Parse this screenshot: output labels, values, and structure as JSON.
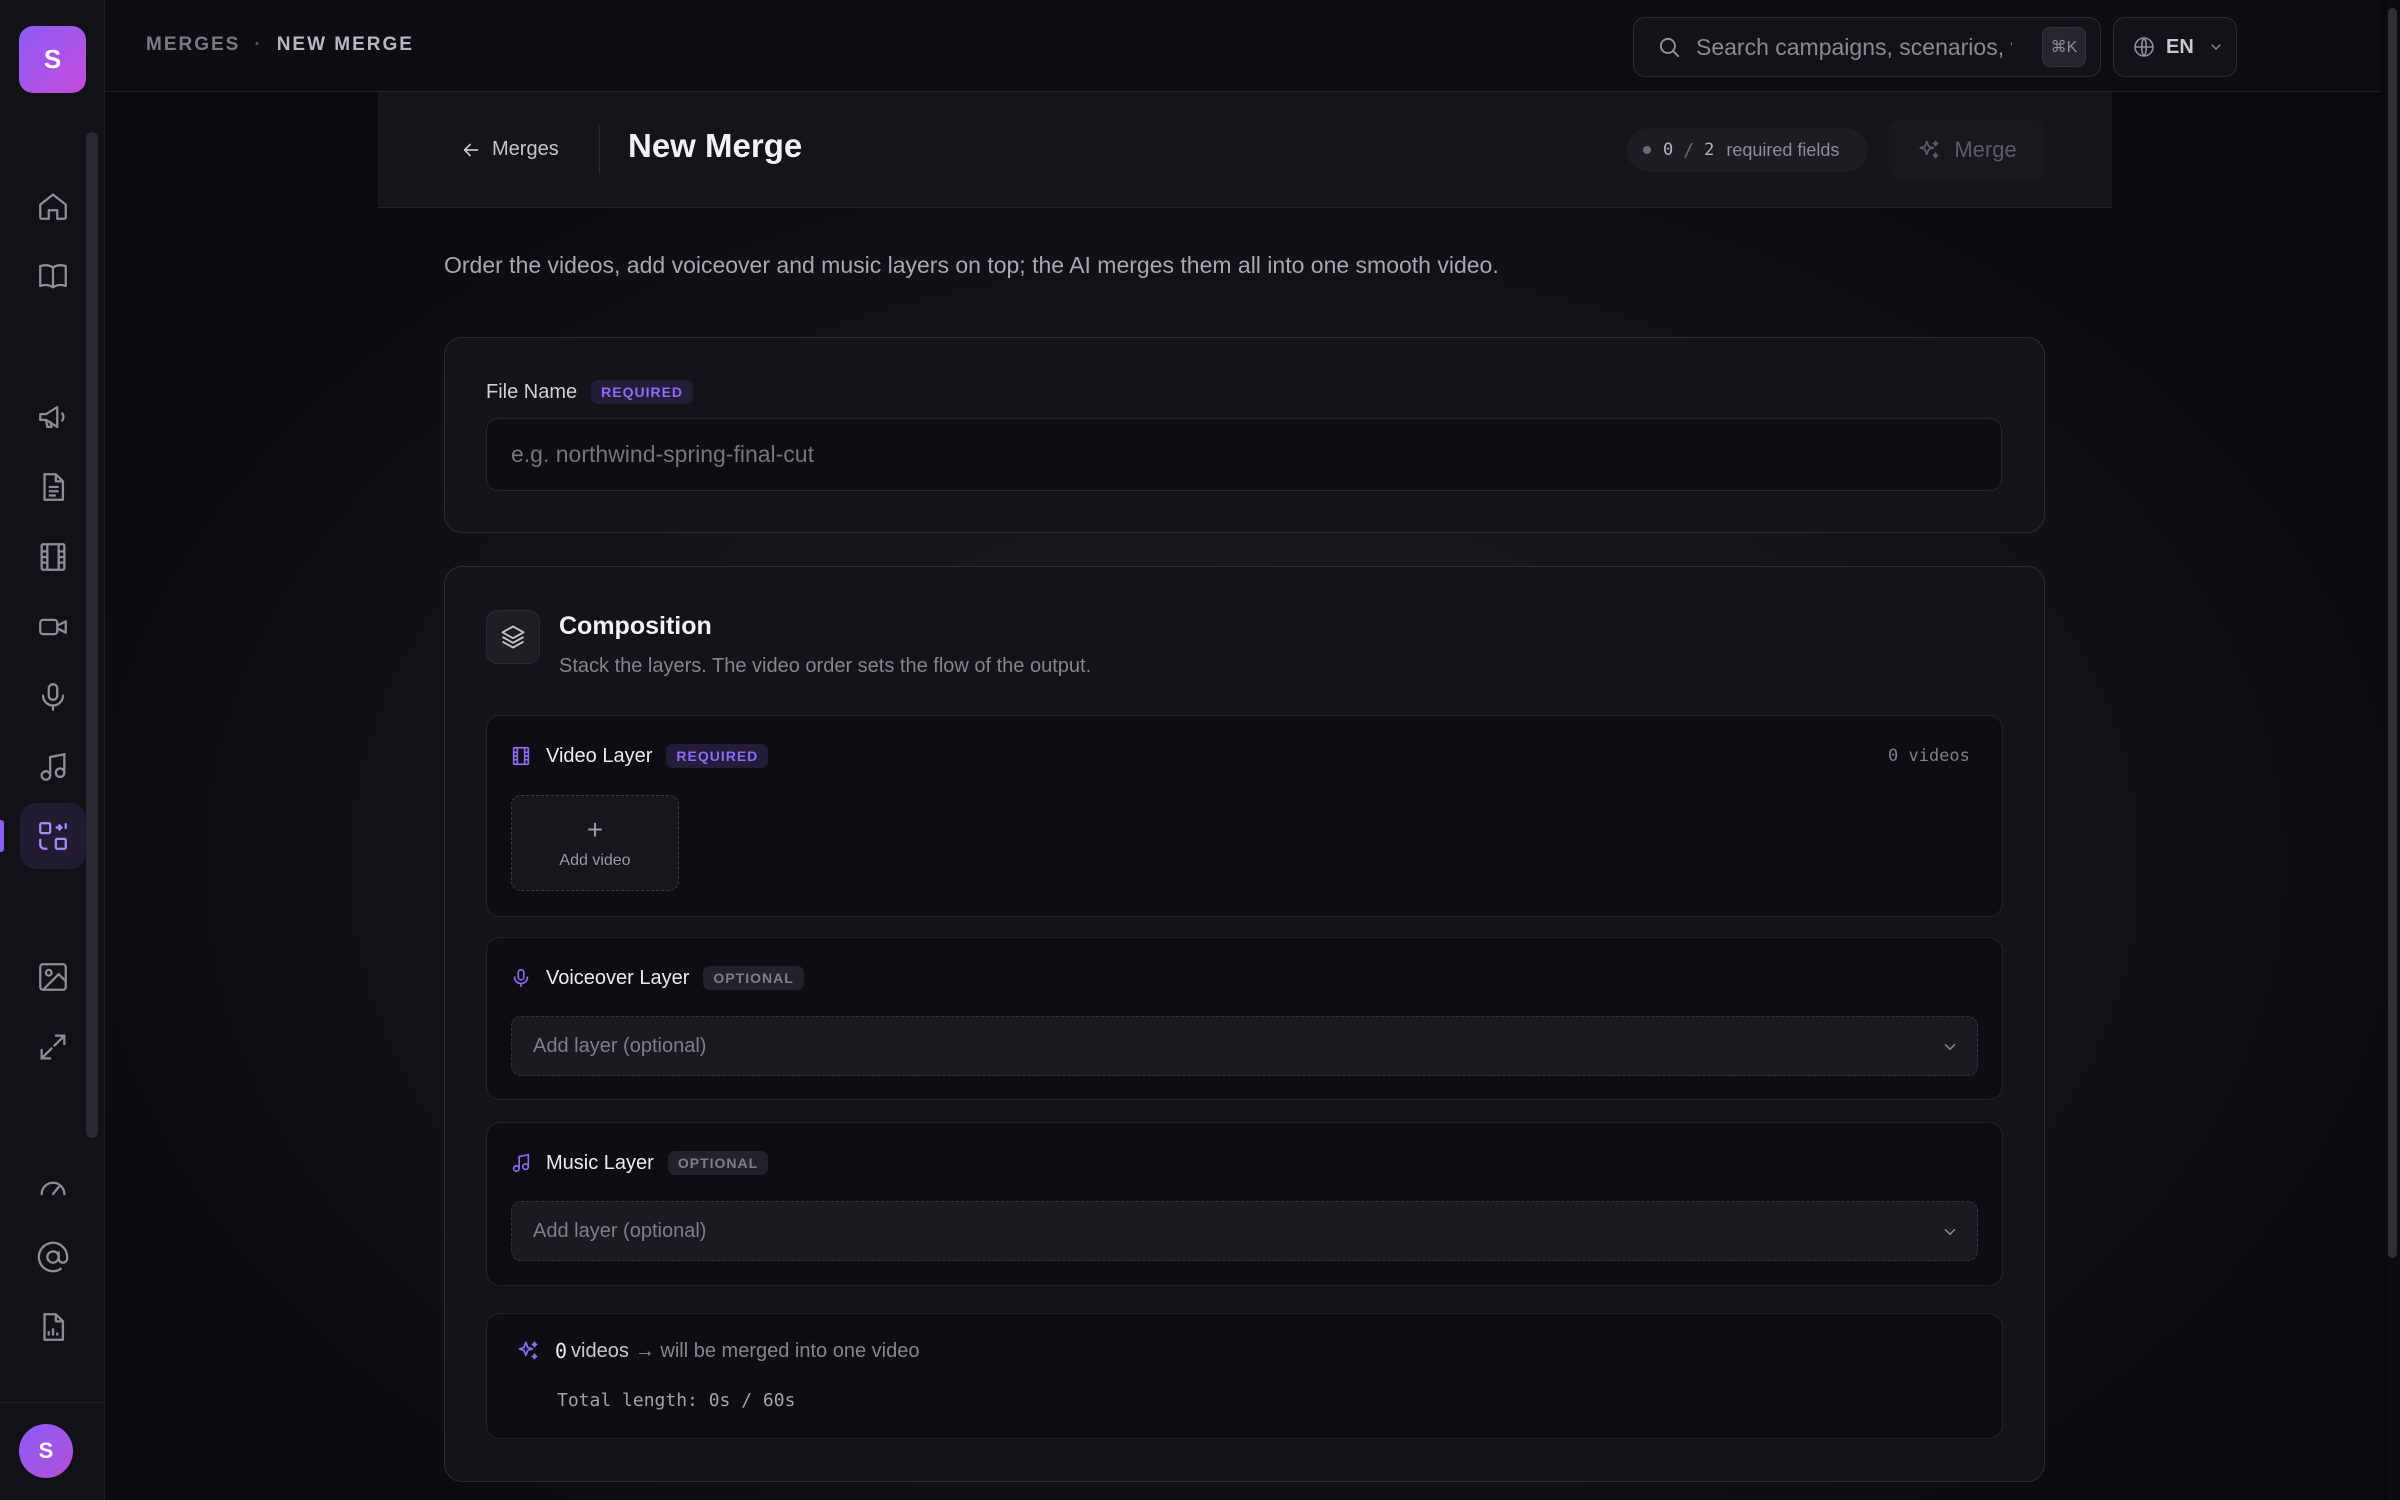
{
  "app": {
    "logo_letter": "S",
    "user_initial": "S",
    "accent": "#8b5cf6"
  },
  "breadcrumb": {
    "parent": "MERGES",
    "separator": "·",
    "current": "NEW MERGE"
  },
  "search": {
    "placeholder": "Search campaigns, scenarios, vi",
    "shortcut": "⌘K"
  },
  "language": {
    "value": "EN"
  },
  "sidebar": {
    "items": [
      {
        "icon": "home-icon"
      },
      {
        "icon": "book-icon"
      },
      {
        "icon": "megaphone-icon"
      },
      {
        "icon": "document-icon"
      },
      {
        "icon": "film-icon"
      },
      {
        "icon": "video-camera-icon"
      },
      {
        "icon": "microphone-icon"
      },
      {
        "icon": "music-note-icon"
      },
      {
        "icon": "merge-icon",
        "active": true
      },
      {
        "icon": "image-icon"
      },
      {
        "icon": "expand-icon"
      },
      {
        "icon": "gauge-icon"
      },
      {
        "icon": "at-sign-icon"
      },
      {
        "icon": "report-icon"
      }
    ]
  },
  "header": {
    "back_label": "Merges",
    "title": "New Merge",
    "required_done": "0",
    "required_total": "2",
    "required_label": "required fields",
    "merge_label": "Merge"
  },
  "description": "Order the videos, add voiceover and music layers on top; the AI merges them all into one smooth video.",
  "file_name": {
    "label": "File Name",
    "badge": "REQUIRED",
    "value": "",
    "placeholder": "e.g. northwind-spring-final-cut"
  },
  "composition": {
    "title": "Composition",
    "subtitle": "Stack the layers. The video order sets the flow of the output.",
    "video_layer": {
      "label": "Video Layer",
      "badge": "REQUIRED",
      "count": "0 videos",
      "add_label": "Add video",
      "add_symbol": "+"
    },
    "voiceover_layer": {
      "label": "Voiceover Layer",
      "badge": "OPTIONAL",
      "select_placeholder": "Add layer (optional)"
    },
    "music_layer": {
      "label": "Music Layer",
      "badge": "OPTIONAL",
      "select_placeholder": "Add layer (optional)"
    },
    "summary": {
      "count": "0",
      "unit": "videos",
      "text": "→ will be merged into one video",
      "total": "Total length: 0s / 60s"
    }
  }
}
